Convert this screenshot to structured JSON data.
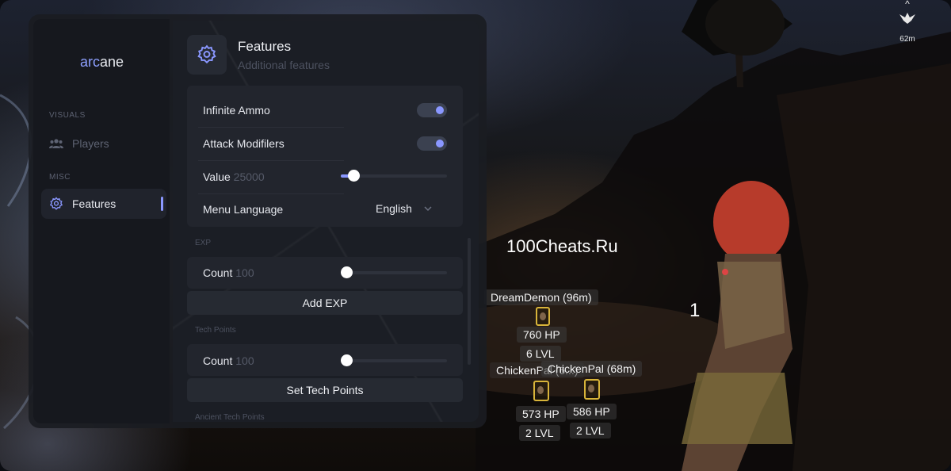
{
  "game": {
    "watermark": "100Cheats.Ru",
    "marker_number": "1",
    "compass": {
      "caret": "^",
      "distance": "62m"
    },
    "pals": [
      {
        "name": "DreamDemon (96m)",
        "hp": "760 HP",
        "level": "6 LVL"
      },
      {
        "name": "ChickenPal (6...)",
        "hp": "573 HP",
        "level": "2 LVL"
      },
      {
        "name": "ChickenPal (68m)",
        "hp": "586 HP",
        "level": "2 LVL"
      }
    ]
  },
  "menu": {
    "logo": {
      "accent": "arc",
      "rest": "ane"
    },
    "sidebar": {
      "groups": [
        {
          "label": "VISUALS",
          "items": [
            {
              "label": "Players",
              "icon": "users-icon",
              "active": false
            }
          ]
        },
        {
          "label": "MISC",
          "items": [
            {
              "label": "Features",
              "icon": "gear-icon",
              "active": true
            }
          ]
        }
      ]
    },
    "header": {
      "title": "Features",
      "subtitle": "Additional features",
      "icon": "gear-icon"
    },
    "options": {
      "infinite_ammo": {
        "label": "Infinite Ammo",
        "enabled": true
      },
      "attack_modifiers": {
        "label": "Attack Modifilers",
        "enabled": true
      },
      "value": {
        "label": "Value",
        "current": "25000",
        "fill_fraction": 0.12
      },
      "menu_language": {
        "label": "Menu Language",
        "selected": "English"
      }
    },
    "exp": {
      "section_label": "EXP",
      "count_label": "Count",
      "count_value": "100",
      "fill_fraction": 0.0,
      "button": "Add EXP"
    },
    "tech_points": {
      "section_label": "Tech Points",
      "count_label": "Count",
      "count_value": "100",
      "fill_fraction": 0.0,
      "button": "Set Tech Points"
    },
    "ancient_tech_points": {
      "section_label": "Ancient Tech Points"
    }
  },
  "colors": {
    "accent": "#8a97ff",
    "panel": "#1b1e25",
    "sidebar": "#16181e",
    "pal_frame": "#d8b43a"
  }
}
